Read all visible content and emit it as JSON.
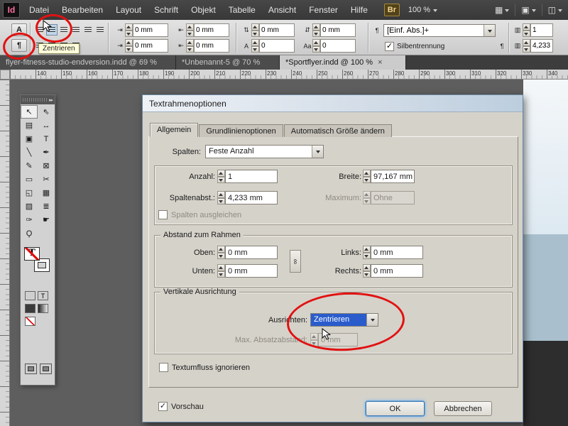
{
  "menubar": {
    "logo": "Id",
    "items": [
      "Datei",
      "Bearbeiten",
      "Layout",
      "Schrift",
      "Objekt",
      "Tabelle",
      "Ansicht",
      "Fenster",
      "Hilfe"
    ],
    "bridge_label": "Br",
    "zoom_value": "100 %"
  },
  "controlbar": {
    "char_mode_label": "A",
    "para_mode_label": "¶",
    "tooltip": "Zentrieren",
    "row1": {
      "f1": "0 mm",
      "f2": "0 mm",
      "f3": "0 mm",
      "f4": "0 mm",
      "cols": "1"
    },
    "row2": {
      "f1": "0 mm",
      "f2": "0 mm",
      "f3": "0",
      "f4": "0",
      "gutter": "4,233"
    },
    "style_dropdown": "[Einf. Abs.]+",
    "hyphenation_label": "Silbentrennung"
  },
  "tabbar": {
    "tabs": [
      {
        "label": "flyer-fitness-studio-endversion.indd @ 69 %"
      },
      {
        "label": "*Unbenannt-5 @ 70 %"
      },
      {
        "label": "*Sportflyer.indd @ 100 %"
      }
    ],
    "close_glyph": "×"
  },
  "ruler": {
    "unit_labels": [
      "140",
      "150",
      "160",
      "170",
      "180",
      "190",
      "200",
      "210",
      "220",
      "230",
      "240",
      "250",
      "260",
      "270",
      "280",
      "290",
      "300",
      "310",
      "320",
      "330",
      "340"
    ]
  },
  "tools": [
    {
      "name": "selection-tool",
      "glyph": "↖"
    },
    {
      "name": "direct-selection-tool",
      "glyph": "⇖"
    },
    {
      "name": "page-tool",
      "glyph": "▤"
    },
    {
      "name": "gap-tool",
      "glyph": "↔"
    },
    {
      "name": "content-collector-tool",
      "glyph": "▣"
    },
    {
      "name": "type-tool",
      "glyph": "T"
    },
    {
      "name": "line-tool",
      "glyph": "╲"
    },
    {
      "name": "pen-tool",
      "glyph": "✒"
    },
    {
      "name": "pencil-tool",
      "glyph": "✎"
    },
    {
      "name": "rectangle-frame-tool",
      "glyph": "⊠"
    },
    {
      "name": "rectangle-tool",
      "glyph": "▭"
    },
    {
      "name": "scissors-tool",
      "glyph": "✂"
    },
    {
      "name": "free-transform-tool",
      "glyph": "◱"
    },
    {
      "name": "gradient-swatch-tool",
      "glyph": "▦"
    },
    {
      "name": "gradient-feather-tool",
      "glyph": "▨"
    },
    {
      "name": "note-tool",
      "glyph": "≣"
    },
    {
      "name": "eyedropper-tool",
      "glyph": "✑"
    },
    {
      "name": "hand-tool",
      "glyph": "☛"
    },
    {
      "name": "zoom-tool",
      "glyph": "Ϙ"
    }
  ],
  "icons": {
    "indent_left": "⇥",
    "indent_right": "⇤",
    "space_before": "⇅",
    "space_after": "⇵",
    "first_line": "⇥",
    "last_line": "⇤",
    "drop_cap_lines": "A",
    "drop_cap_chars": "Aa",
    "pilcrow": "¶",
    "columns": "▥",
    "check": "✓",
    "link": "∞",
    "grid": "▦",
    "screen": "▣",
    "arrange": "◫",
    "collapse": "▸▸",
    "type_t": "T"
  },
  "dialog": {
    "title": "Textrahmenoptionen",
    "tabs": [
      "Allgemein",
      "Grundlinienoptionen",
      "Automatisch Größe ändern"
    ],
    "spalten": {
      "label": "Spalten:",
      "value": "Feste Anzahl"
    },
    "anzahl": {
      "label": "Anzahl:",
      "value": "1"
    },
    "breite": {
      "label": "Breite:",
      "value": "97,167 mm"
    },
    "spaltenabstand": {
      "label": "Spaltenabst.:",
      "value": "4,233 mm"
    },
    "maximum": {
      "label": "Maximum:",
      "value": "Ohne"
    },
    "spalten_ausgleichen_label": "Spalten ausgleichen",
    "abstand_group": {
      "title": "Abstand zum Rahmen",
      "oben": {
        "label": "Oben:",
        "value": "0 mm"
      },
      "unten": {
        "label": "Unten:",
        "value": "0 mm"
      },
      "links": {
        "label": "Links:",
        "value": "0 mm"
      },
      "rechts": {
        "label": "Rechts:",
        "value": "0 mm"
      }
    },
    "vertikal_group": {
      "title": "Vertikale Ausrichtung",
      "ausrichten": {
        "label": "Ausrichten:",
        "value": "Zentrieren"
      },
      "max_absatzabstand": {
        "label": "Max. Absatzabstand:",
        "value": "0 mm"
      }
    },
    "textumfluss_label": "Textumfluss ignorieren",
    "vorschau_label": "Vorschau",
    "ok_label": "OK",
    "abbrechen_label": "Abbrechen"
  },
  "colors": {
    "annotation_red": "#e11212",
    "selection_blue": "#2a5ccc",
    "tooltip_yellow": "#ffffdc",
    "dialog_gray": "#d5d2ca"
  }
}
